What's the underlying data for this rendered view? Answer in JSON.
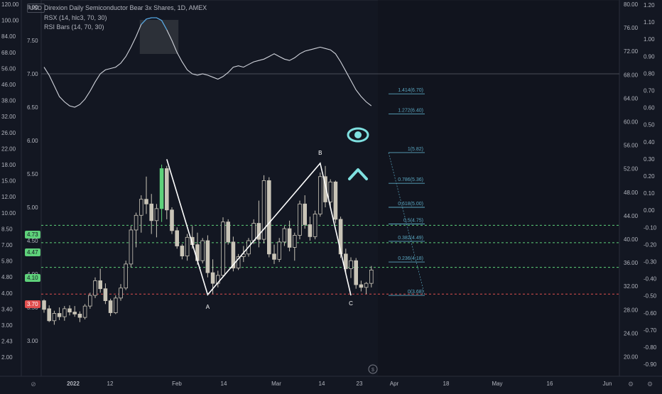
{
  "header": {
    "title": "Direxion Daily Semiconductor Bear 3x Shares, 1D, AMEX",
    "indicator1": "RSX (14, hlc3, 70, 30)",
    "indicator2": "RSI Bars (14, 70, 30)",
    "currency": "USD"
  },
  "colors": {
    "background": "#131722",
    "axis_text": "#b2b5be",
    "rsx_line": "#d1d4dc",
    "rsx_highlight": "#4fa3e0",
    "candle": "#c9c4b7",
    "fib": "#5aa6c0",
    "green_level": "#5ed17a",
    "red_level": "#e04e4e",
    "accent_icons": "#7fe0e0",
    "abc_lines": "#ffffff"
  },
  "chart_data": {
    "type": "candlestick",
    "title": "Direxion Daily Semiconductor Bear 3x Shares, 1D, AMEX",
    "y_axis_left_ticks": [
      "120.00",
      "100.00",
      "84.00",
      "68.00",
      "56.00",
      "46.00",
      "38.00",
      "32.00",
      "26.00",
      "22.00",
      "18.00",
      "15.00",
      "12.00",
      "10.00",
      "8.50",
      "7.00",
      "5.80",
      "4.80",
      "4.00",
      "3.40",
      "3.00",
      "2.43",
      "2.00"
    ],
    "y_axis_inner_ticks": [
      "8.00",
      "7.50",
      "7.00",
      "6.50",
      "6.00",
      "5.50",
      "5.00",
      "4.50",
      "4.00",
      "3.50",
      "3.00"
    ],
    "y_axis_right1_ticks": [
      "80.00",
      "76.00",
      "72.00",
      "68.00",
      "64.00",
      "60.00",
      "56.00",
      "52.00",
      "48.00",
      "44.00",
      "40.00",
      "36.00",
      "32.00",
      "28.00",
      "24.00",
      "20.00"
    ],
    "y_axis_right2_ticks": [
      "1.20",
      "1.10",
      "1.00",
      "0.90",
      "0.80",
      "0.70",
      "0.60",
      "0.50",
      "0.40",
      "0.30",
      "0.20",
      "0.10",
      "0.00",
      "-0.10",
      "-0.20",
      "-0.30",
      "-0.40",
      "-0.50",
      "-0.60",
      "-0.70",
      "-0.80",
      "-0.90"
    ],
    "x_axis_labels": [
      "2022",
      "12",
      "Feb",
      "14",
      "Mar",
      "14",
      "23",
      "Apr",
      "18",
      "May",
      "16",
      "Jun"
    ],
    "price_badges": [
      {
        "label": "4.73",
        "color": "green"
      },
      {
        "label": "4.47",
        "color": "green"
      },
      {
        "label": "4.10",
        "color": "green"
      },
      {
        "label": "3.70",
        "color": "red"
      }
    ],
    "fib_levels": [
      {
        "label": "1.414(6.70)",
        "ratio": 1.414,
        "price": 6.7
      },
      {
        "label": "1.272(6.40)",
        "ratio": 1.272,
        "price": 6.4
      },
      {
        "label": "1(5.82)",
        "ratio": 1,
        "price": 5.82
      },
      {
        "label": "0.786(5.36)",
        "ratio": 0.786,
        "price": 5.36
      },
      {
        "label": "0.618(5.00)",
        "ratio": 0.618,
        "price": 5.0
      },
      {
        "label": "0.5(4.75)",
        "ratio": 0.5,
        "price": 4.75
      },
      {
        "label": "0.382(4.49)",
        "ratio": 0.382,
        "price": 4.49
      },
      {
        "label": "0.236(4.18)",
        "ratio": 0.236,
        "price": 4.18
      },
      {
        "label": "0(3.68)",
        "ratio": 0,
        "price": 3.68
      }
    ],
    "abc_points": [
      {
        "label": "A",
        "price": 3.69
      },
      {
        "label": "B",
        "price": 5.66
      },
      {
        "label": "C",
        "price": 3.68
      }
    ],
    "candles": [
      {
        "o": 3.6,
        "h": 3.62,
        "l": 3.42,
        "c": 3.47
      },
      {
        "o": 3.48,
        "h": 3.53,
        "l": 3.28,
        "c": 3.3
      },
      {
        "o": 3.3,
        "h": 3.45,
        "l": 3.24,
        "c": 3.41
      },
      {
        "o": 3.41,
        "h": 3.5,
        "l": 3.31,
        "c": 3.36
      },
      {
        "o": 3.36,
        "h": 3.52,
        "l": 3.3,
        "c": 3.48
      },
      {
        "o": 3.48,
        "h": 3.53,
        "l": 3.38,
        "c": 3.43
      },
      {
        "o": 3.43,
        "h": 3.52,
        "l": 3.36,
        "c": 3.4
      },
      {
        "o": 3.4,
        "h": 3.44,
        "l": 3.28,
        "c": 3.35
      },
      {
        "o": 3.35,
        "h": 3.55,
        "l": 3.32,
        "c": 3.52
      },
      {
        "o": 3.52,
        "h": 3.72,
        "l": 3.48,
        "c": 3.68
      },
      {
        "o": 3.68,
        "h": 3.95,
        "l": 3.64,
        "c": 3.9
      },
      {
        "o": 3.9,
        "h": 4.08,
        "l": 3.72,
        "c": 3.78
      },
      {
        "o": 3.78,
        "h": 3.86,
        "l": 3.55,
        "c": 3.6
      },
      {
        "o": 3.6,
        "h": 3.63,
        "l": 3.37,
        "c": 3.42
      },
      {
        "o": 3.42,
        "h": 3.68,
        "l": 3.4,
        "c": 3.64
      },
      {
        "o": 3.64,
        "h": 3.85,
        "l": 3.6,
        "c": 3.79
      },
      {
        "o": 3.79,
        "h": 4.2,
        "l": 3.76,
        "c": 4.15
      },
      {
        "o": 4.15,
        "h": 4.72,
        "l": 4.1,
        "c": 4.66
      },
      {
        "o": 4.66,
        "h": 4.92,
        "l": 4.4,
        "c": 4.88
      },
      {
        "o": 4.88,
        "h": 5.18,
        "l": 4.62,
        "c": 5.12
      },
      {
        "o": 5.12,
        "h": 5.46,
        "l": 4.9,
        "c": 5.05
      },
      {
        "o": 5.05,
        "h": 5.2,
        "l": 4.6,
        "c": 4.8
      },
      {
        "o": 4.8,
        "h": 5.05,
        "l": 4.55,
        "c": 4.98
      },
      {
        "o": 4.98,
        "h": 5.64,
        "l": 4.78,
        "c": 5.58
      },
      {
        "o": 5.58,
        "h": 5.62,
        "l": 4.82,
        "c": 4.96
      },
      {
        "o": 4.96,
        "h": 5.0,
        "l": 4.6,
        "c": 4.65
      },
      {
        "o": 4.65,
        "h": 4.7,
        "l": 4.38,
        "c": 4.42
      },
      {
        "o": 4.42,
        "h": 4.45,
        "l": 4.22,
        "c": 4.27
      },
      {
        "o": 4.27,
        "h": 4.6,
        "l": 4.2,
        "c": 4.55
      },
      {
        "o": 4.55,
        "h": 4.72,
        "l": 4.38,
        "c": 4.44
      },
      {
        "o": 4.44,
        "h": 4.62,
        "l": 4.14,
        "c": 4.2
      },
      {
        "o": 4.2,
        "h": 4.54,
        "l": 4.16,
        "c": 4.5
      },
      {
        "o": 4.5,
        "h": 4.58,
        "l": 3.95,
        "c": 4.02
      },
      {
        "o": 4.02,
        "h": 4.22,
        "l": 3.7,
        "c": 3.86
      },
      {
        "o": 3.86,
        "h": 4.05,
        "l": 3.8,
        "c": 3.98
      },
      {
        "o": 3.98,
        "h": 4.85,
        "l": 3.95,
        "c": 4.78
      },
      {
        "o": 4.78,
        "h": 4.82,
        "l": 4.44,
        "c": 4.48
      },
      {
        "o": 4.48,
        "h": 4.56,
        "l": 4.04,
        "c": 4.09
      },
      {
        "o": 4.09,
        "h": 4.3,
        "l": 4.06,
        "c": 4.26
      },
      {
        "o": 4.26,
        "h": 4.42,
        "l": 4.18,
        "c": 4.3
      },
      {
        "o": 4.3,
        "h": 4.54,
        "l": 4.26,
        "c": 4.5
      },
      {
        "o": 4.5,
        "h": 4.82,
        "l": 4.45,
        "c": 4.76
      },
      {
        "o": 4.76,
        "h": 5.1,
        "l": 4.4,
        "c": 4.52
      },
      {
        "o": 4.52,
        "h": 5.48,
        "l": 4.46,
        "c": 5.4
      },
      {
        "o": 5.4,
        "h": 5.45,
        "l": 4.25,
        "c": 4.3
      },
      {
        "o": 4.3,
        "h": 4.44,
        "l": 4.15,
        "c": 4.22
      },
      {
        "o": 4.22,
        "h": 4.54,
        "l": 4.18,
        "c": 4.48
      },
      {
        "o": 4.48,
        "h": 4.72,
        "l": 4.42,
        "c": 4.68
      },
      {
        "o": 4.68,
        "h": 4.8,
        "l": 4.34,
        "c": 4.4
      },
      {
        "o": 4.4,
        "h": 4.62,
        "l": 4.2,
        "c": 4.58
      },
      {
        "o": 4.58,
        "h": 5.1,
        "l": 4.52,
        "c": 5.05
      },
      {
        "o": 5.05,
        "h": 5.18,
        "l": 4.68,
        "c": 4.74
      },
      {
        "o": 4.74,
        "h": 4.86,
        "l": 4.5,
        "c": 4.56
      },
      {
        "o": 4.56,
        "h": 4.95,
        "l": 4.52,
        "c": 4.9
      },
      {
        "o": 4.9,
        "h": 5.52,
        "l": 4.86,
        "c": 5.46
      },
      {
        "o": 5.46,
        "h": 5.62,
        "l": 5.0,
        "c": 5.08
      },
      {
        "o": 5.08,
        "h": 5.42,
        "l": 5.02,
        "c": 5.38
      },
      {
        "o": 5.38,
        "h": 5.4,
        "l": 4.76,
        "c": 4.82
      },
      {
        "o": 4.82,
        "h": 4.86,
        "l": 4.24,
        "c": 4.3
      },
      {
        "o": 4.3,
        "h": 4.38,
        "l": 4.02,
        "c": 4.08
      },
      {
        "o": 4.08,
        "h": 4.25,
        "l": 3.94,
        "c": 4.2
      },
      {
        "o": 4.2,
        "h": 4.24,
        "l": 3.78,
        "c": 3.84
      },
      {
        "o": 3.84,
        "h": 3.9,
        "l": 3.74,
        "c": 3.8
      },
      {
        "o": 3.8,
        "h": 3.88,
        "l": 3.7,
        "c": 3.86
      },
      {
        "o": 3.86,
        "h": 4.12,
        "l": 3.8,
        "c": 4.06
      }
    ],
    "rsi_highlight_bars": [
      {
        "index": 23,
        "color": "green"
      }
    ],
    "rsx_line": [
      7.1,
      6.98,
      6.82,
      6.66,
      6.58,
      6.52,
      6.5,
      6.54,
      6.62,
      6.74,
      6.88,
      7.0,
      7.06,
      7.08,
      7.1,
      7.16,
      7.26,
      7.4,
      7.56,
      7.74,
      7.82,
      7.84,
      7.84,
      7.8,
      7.66,
      7.5,
      7.32,
      7.18,
      7.06,
      7.0,
      6.98,
      7.0,
      6.98,
      6.95,
      6.92,
      6.96,
      7.02,
      7.1,
      7.12,
      7.1,
      7.14,
      7.18,
      7.2,
      7.22,
      7.26,
      7.3,
      7.26,
      7.22,
      7.2,
      7.24,
      7.3,
      7.34,
      7.36,
      7.38,
      7.4,
      7.38,
      7.36,
      7.3,
      7.18,
      7.04,
      6.9,
      6.76,
      6.66,
      6.58,
      6.52
    ]
  }
}
